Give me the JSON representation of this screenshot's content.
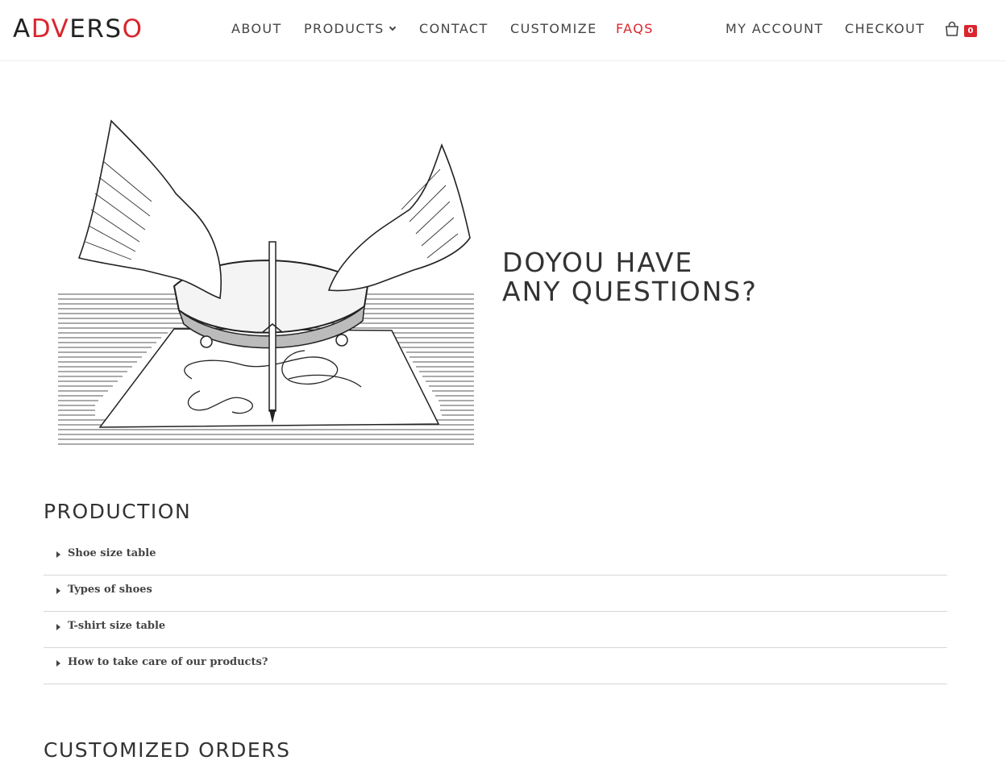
{
  "header": {
    "logo": {
      "part1": "A",
      "part2": "DV",
      "part3": "ERS",
      "part4": "O"
    },
    "nav": [
      {
        "label": "ABOUT"
      },
      {
        "label": "PRODUCTS"
      },
      {
        "label": "CONTACT"
      },
      {
        "label": "CUSTOMIZE"
      },
      {
        "label": "FAQS"
      },
      {
        "label": "MY ACCOUNT"
      },
      {
        "label": "CHECKOUT"
      }
    ],
    "cart_count": "0",
    "accent_color": "#d9262e"
  },
  "hero": {
    "title_line1": "DOYOU HAVE",
    "title_line2": "ANY QUESTIONS?",
    "illustration": "planchette-drawing-engraving"
  },
  "sections": [
    {
      "title": "PRODUCTION",
      "items": [
        {
          "label": "Shoe size table"
        },
        {
          "label": "Types of shoes"
        },
        {
          "label": "T-shirt size table"
        },
        {
          "label": "How to take care of our products?"
        }
      ]
    },
    {
      "title": "CUSTOMIZED ORDERS"
    }
  ]
}
